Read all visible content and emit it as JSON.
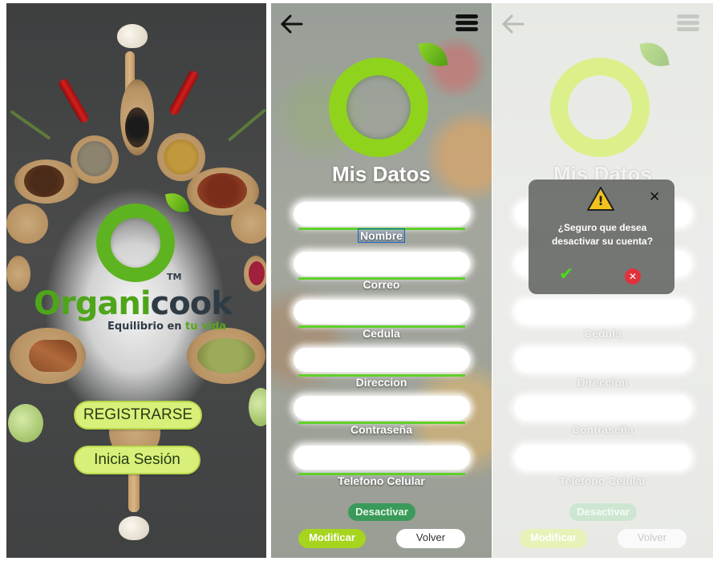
{
  "splash": {
    "brand_part1": "Organi",
    "brand_part2": "cook",
    "trademark": "TM",
    "tagline_part1": "Equilibrio en ",
    "tagline_part2": "tu vida",
    "register_button": "REGISTRARSE",
    "login_button": "Inicia Sesión"
  },
  "profile": {
    "title": "Mis Datos",
    "fields": [
      {
        "label": "Nombre"
      },
      {
        "label": "Correo"
      },
      {
        "label": "Cedula"
      },
      {
        "label": "Direccion"
      },
      {
        "label": "Contraseña"
      },
      {
        "label": "Telefono Celular"
      }
    ],
    "deactivate_button": "Desactivar",
    "modify_button": "Modificar",
    "back_button": "Volver"
  },
  "dialog": {
    "message": "¿Seguro que desea desactivar su cuenta?",
    "warning_glyph": "!",
    "close_glyph": "✕",
    "confirm_glyph": "✔",
    "cancel_glyph": "✕"
  },
  "colors": {
    "brand_green": "#4ea51a",
    "brand_dark": "#2f3b44",
    "button_lime": "#d8f07a",
    "field_underline": "#5fd02a",
    "deactivate": "#3a9a5a",
    "modify": "#a6d41f"
  },
  "icons": {
    "back": "arrow-left-icon",
    "menu": "hamburger-menu-icon",
    "warning": "warning-triangle-icon",
    "confirm": "check-icon",
    "cancel": "cancel-circle-icon"
  }
}
